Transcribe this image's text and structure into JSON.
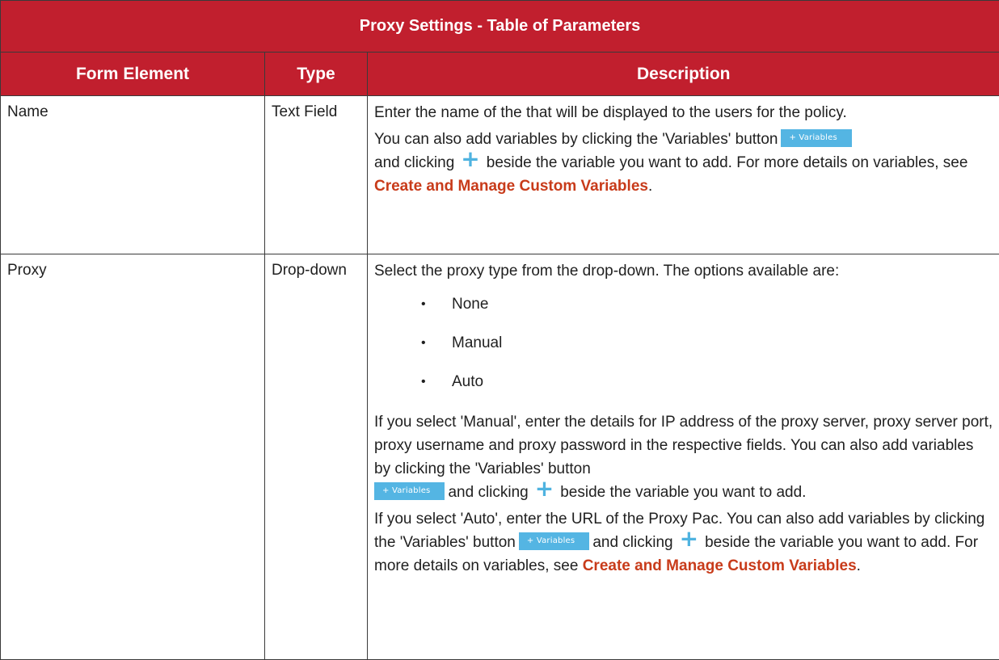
{
  "table": {
    "title": "Proxy Settings - Table of Parameters",
    "headers": [
      "Form Element",
      "Type",
      "Description"
    ]
  },
  "rows": {
    "name": {
      "element": "Name",
      "type": "Text Field",
      "desc_line1": "Enter the name of the that will be displayed to the users for the policy.",
      "desc_a": "You can also add variables by clicking the 'Variables' button",
      "desc_b": "and clicking",
      "desc_c": "beside the variable you want to add. For more details on variables, see",
      "link": "Create and Manage Custom Variables",
      "end": "."
    },
    "proxy": {
      "element": "Proxy",
      "type": "Drop-down",
      "intro": "Select the proxy type from the drop-down. The options available are:",
      "options": [
        "None",
        "Manual",
        "Auto"
      ],
      "bullet": "•",
      "manual_a": "If you select 'Manual', enter the details for IP address of the proxy server, proxy server port, proxy username and proxy password in the respective fields. You can also add variables by clicking the 'Variables' button",
      "manual_b": "and clicking",
      "manual_c": "beside the variable you want to add.",
      "auto_a": "If you select 'Auto', enter the URL of the Proxy Pac. You can also add variables by clicking the 'Variables' button",
      "auto_b": "and clicking",
      "auto_c": "beside the variable you want to add. For more details on variables, see",
      "link": "Create and Manage Custom Variables",
      "end": "."
    }
  },
  "controls": {
    "variables_button": "+ Variables",
    "plus_glyph": "+"
  },
  "colors": {
    "header_bg": "#c11f2e",
    "link": "#c83b1a",
    "variables_button": "#54b5e3"
  }
}
